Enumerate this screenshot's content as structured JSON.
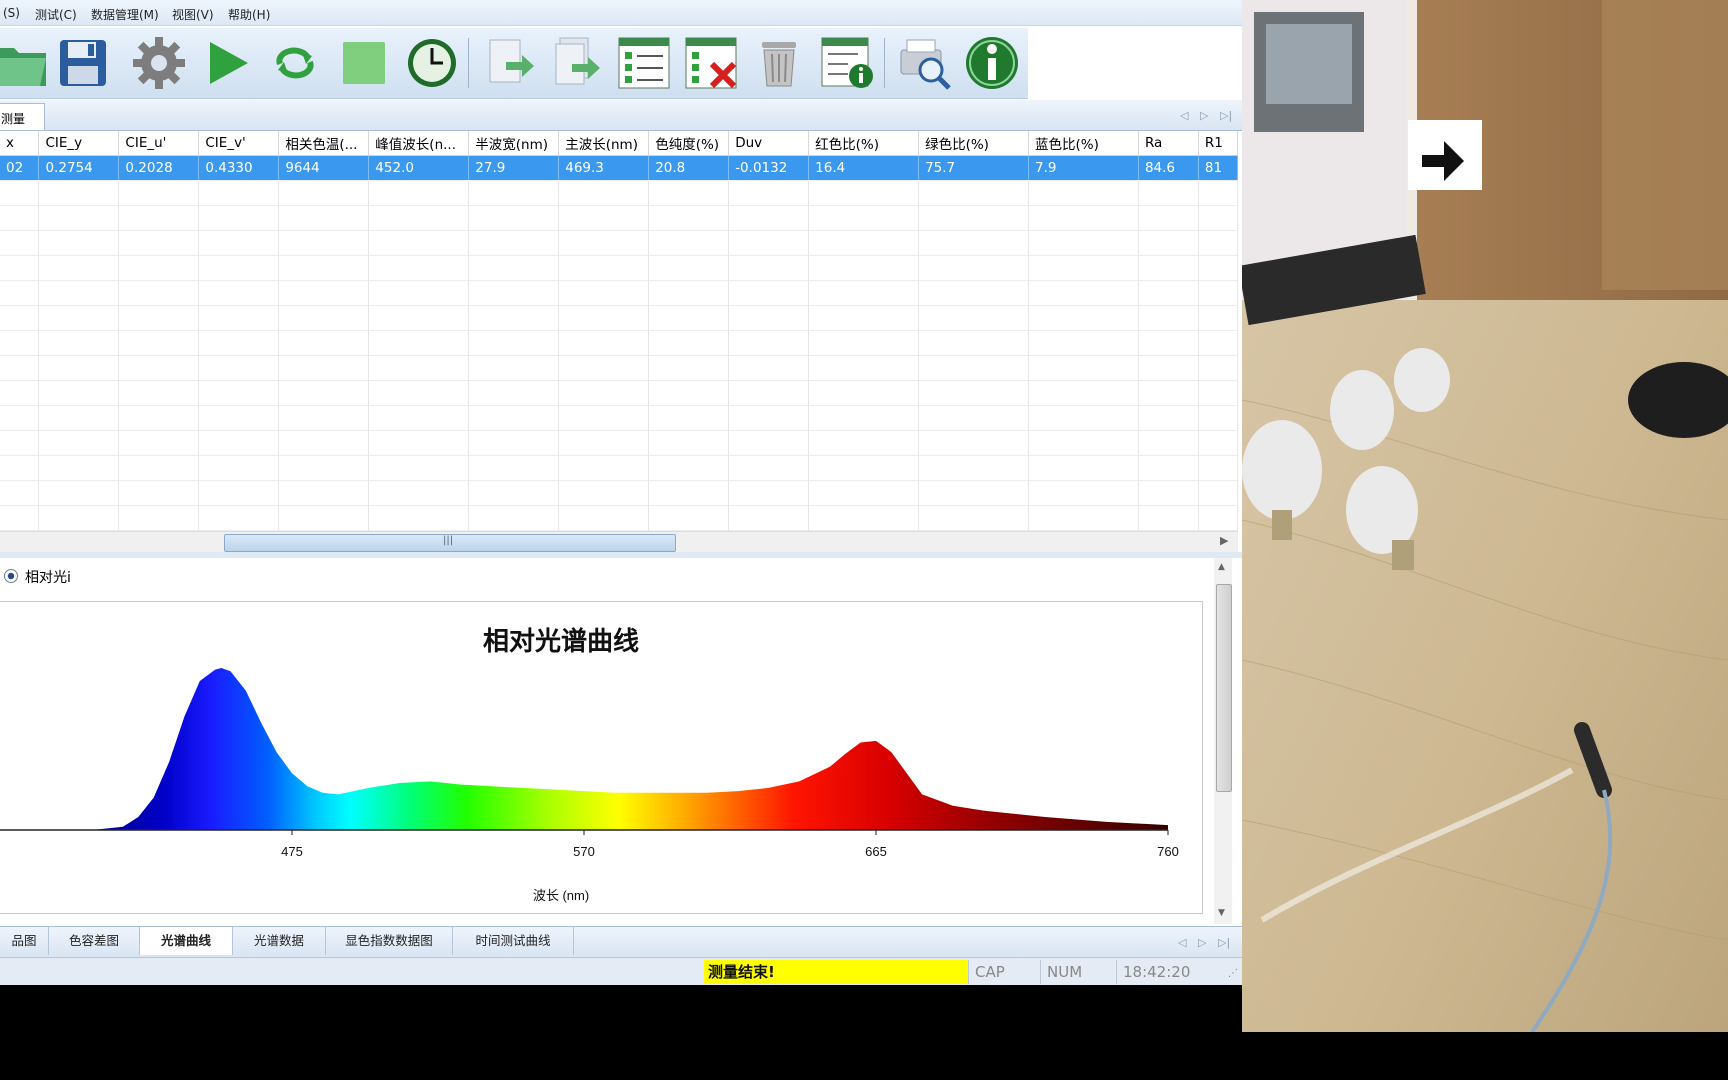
{
  "menu": [
    {
      "label": "(S)"
    },
    {
      "label": "测试(C)"
    },
    {
      "label": "数据管理(M)"
    },
    {
      "label": "视图(V)"
    },
    {
      "label": "帮助(H)"
    }
  ],
  "toolbar": {
    "icons": [
      "open-folder-icon",
      "save-icon",
      "settings-gear-icon",
      "play-icon",
      "loop-icon",
      "stop-icon",
      "clock-icon",
      "export-icon",
      "export-all-icon",
      "checklist-icon",
      "delete-list-icon",
      "trash-icon",
      "info-table-icon",
      "print-preview-icon",
      "info-icon"
    ]
  },
  "doc_tab": {
    "label": "测量"
  },
  "table": {
    "columns": [
      "x",
      "CIE_y",
      "CIE_u'",
      "CIE_v'",
      "相关色温(...",
      "峰值波长(n...",
      "半波宽(nm)",
      "主波长(nm)",
      "色纯度(%)",
      "Duv",
      "红色比(%)",
      "绿色比(%)",
      "蓝色比(%)",
      "Ra",
      "R1"
    ],
    "rows": [
      [
        "02",
        "0.2754",
        "0.2028",
        "0.4330",
        "9644",
        "452.0",
        "27.9",
        "469.3",
        "20.8",
        "-0.0132",
        "16.4",
        "75.7",
        "7.9",
        "84.6",
        "81"
      ]
    ],
    "empty_rows": 14,
    "selected_row": 0
  },
  "chart_panel": {
    "radio_label": "相对光i"
  },
  "chart_data": {
    "type": "area",
    "title": "相对光谱曲线",
    "xlabel": "波长 (nm)",
    "ylabel": "",
    "xlim": [
      380,
      760
    ],
    "x_ticks": [
      475,
      570,
      665,
      760
    ],
    "grid": false,
    "series": [
      {
        "x": [
          380,
          400,
          410,
          420,
          425,
          430,
          435,
          440,
          445,
          450,
          452,
          455,
          460,
          465,
          470,
          475,
          480,
          485,
          490,
          495,
          500,
          510,
          520,
          530,
          540,
          550,
          560,
          570,
          580,
          590,
          600,
          610,
          620,
          630,
          640,
          650,
          655,
          660,
          665,
          670,
          675,
          680,
          690,
          700,
          720,
          740,
          760
        ],
        "y": [
          0,
          0,
          0,
          0.02,
          0.08,
          0.2,
          0.42,
          0.7,
          0.92,
          0.99,
          1.0,
          0.98,
          0.86,
          0.66,
          0.48,
          0.35,
          0.27,
          0.23,
          0.22,
          0.24,
          0.26,
          0.29,
          0.3,
          0.28,
          0.27,
          0.26,
          0.25,
          0.24,
          0.23,
          0.23,
          0.23,
          0.23,
          0.24,
          0.26,
          0.3,
          0.39,
          0.47,
          0.54,
          0.55,
          0.48,
          0.35,
          0.22,
          0.15,
          0.12,
          0.08,
          0.05,
          0.03
        ]
      }
    ]
  },
  "bottom_tabs": [
    {
      "label": "品图"
    },
    {
      "label": "色容差图"
    },
    {
      "label": "光谱曲线"
    },
    {
      "label": "光谱数据"
    },
    {
      "label": "显色指数数据图"
    },
    {
      "label": "时间测试曲线"
    }
  ],
  "status": {
    "message": "测量结束!",
    "cap": "CAP",
    "num": "NUM",
    "time": "18:42:20"
  },
  "colors": {
    "selection": "#3a98ee",
    "status_highlight": "#ffff00",
    "spectrum_peak_blue": "#1a1acc"
  }
}
